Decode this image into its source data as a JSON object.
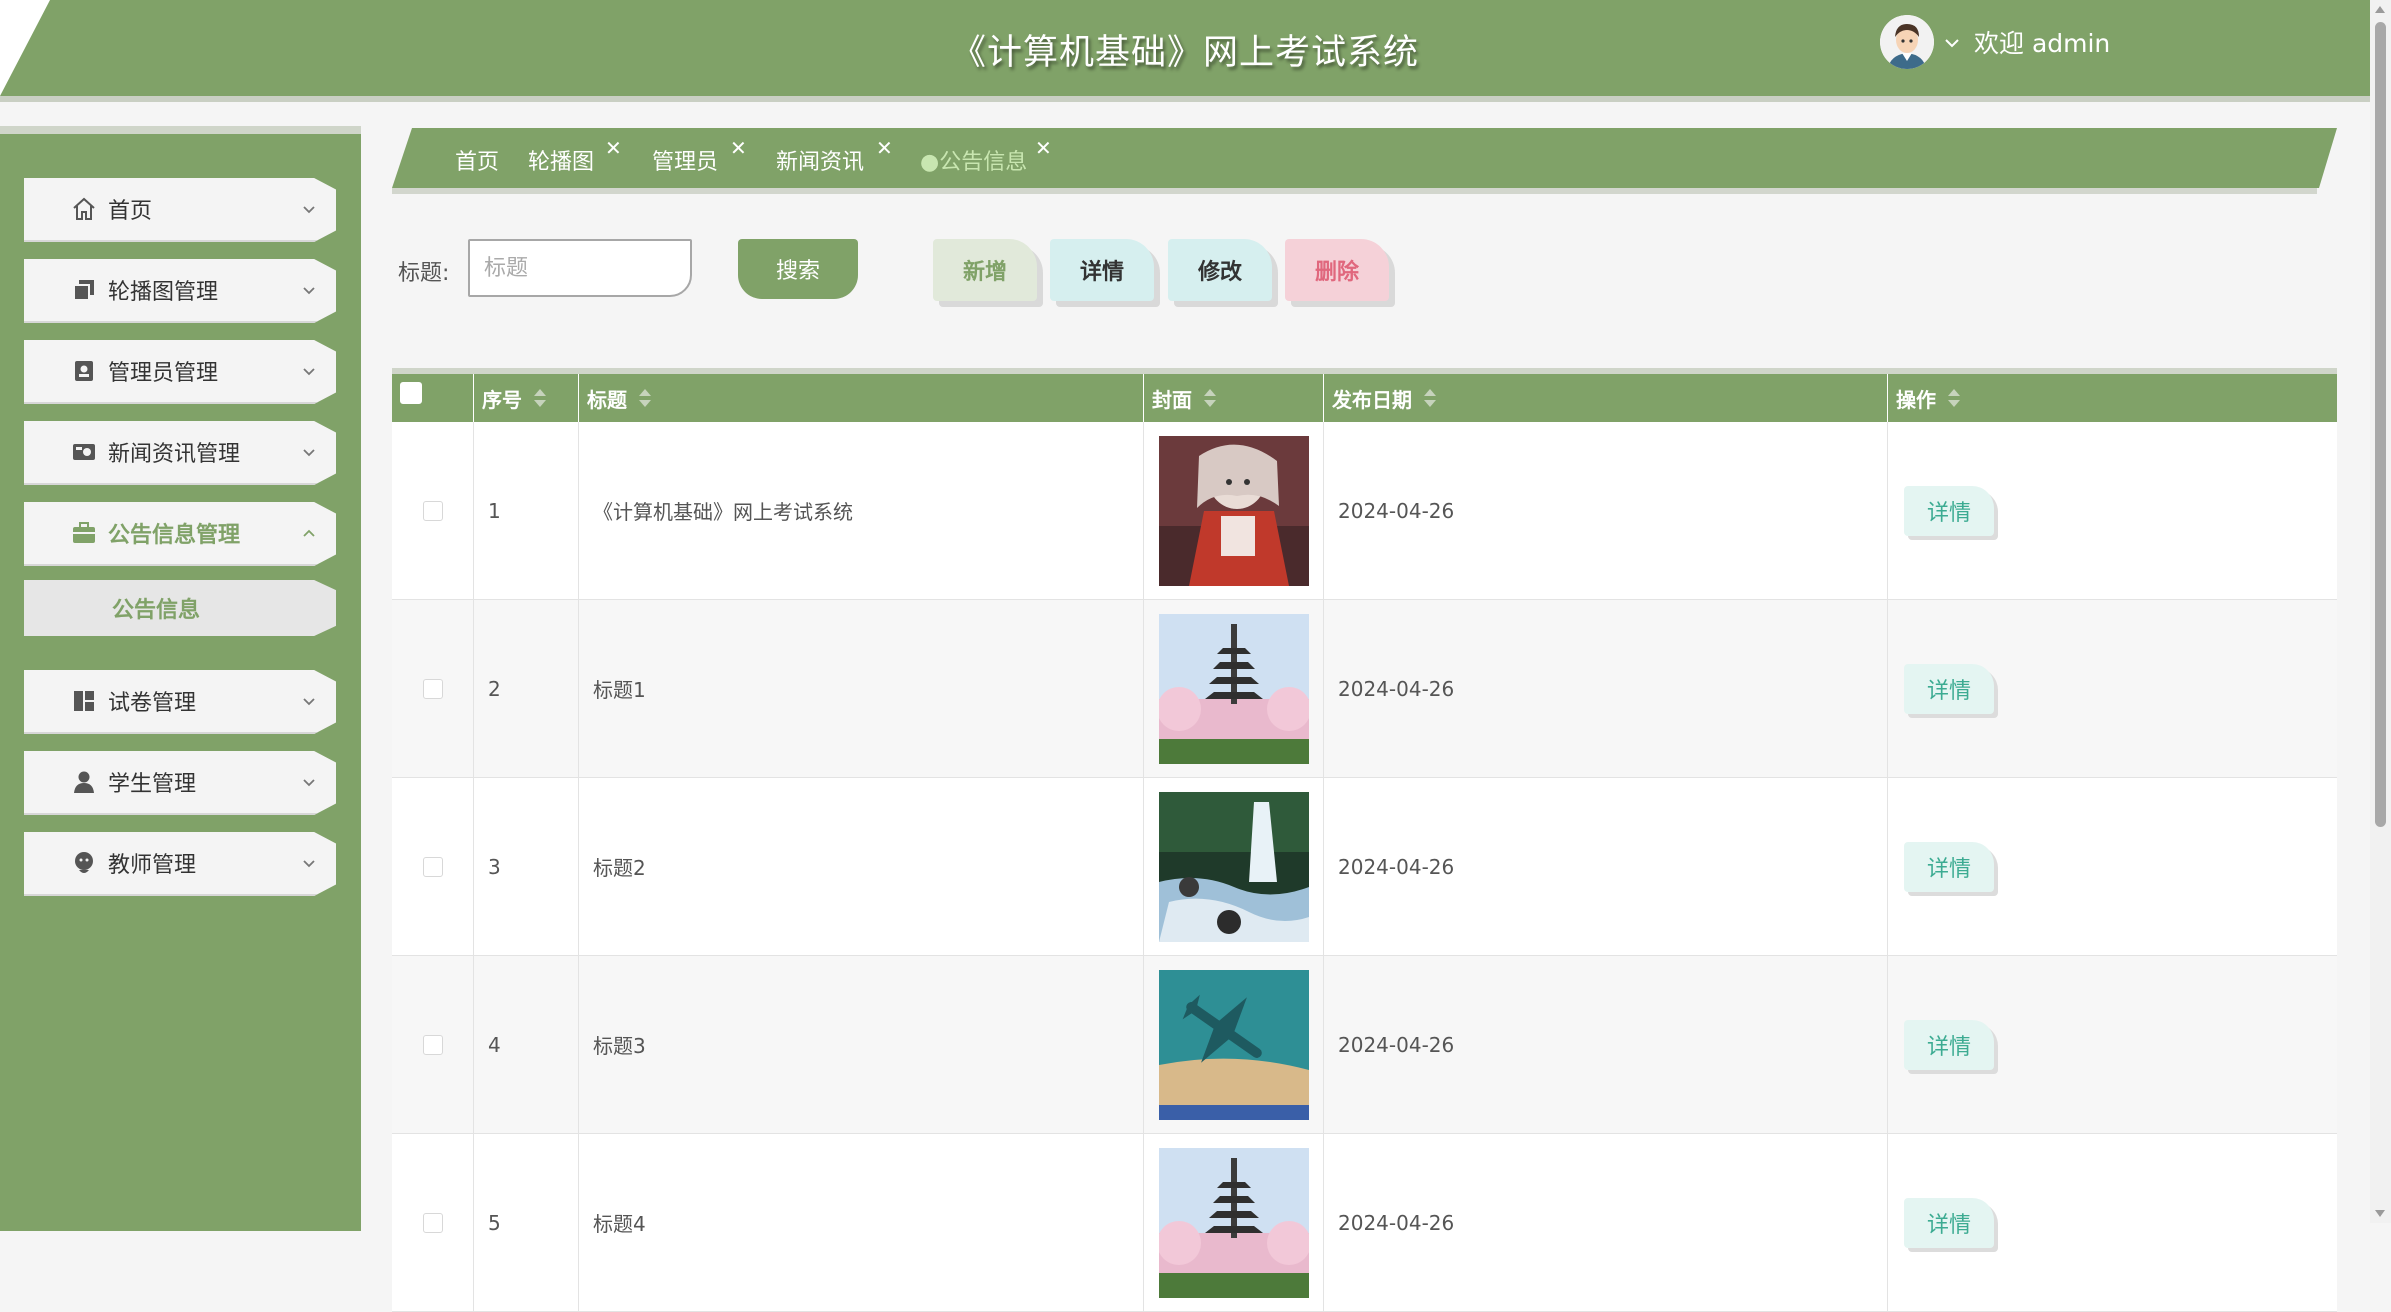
{
  "header": {
    "title": "《计算机基础》网上考试系统",
    "welcome": "欢迎 admin"
  },
  "sidebar": {
    "items": [
      {
        "label": "首页",
        "icon": "home-icon"
      },
      {
        "label": "轮播图管理",
        "icon": "carousel-icon"
      },
      {
        "label": "管理员管理",
        "icon": "admin-icon"
      },
      {
        "label": "新闻资讯管理",
        "icon": "news-icon"
      },
      {
        "label": "公告信息管理",
        "icon": "notice-icon"
      },
      {
        "label": "试卷管理",
        "icon": "paper-icon"
      },
      {
        "label": "学生管理",
        "icon": "student-icon"
      },
      {
        "label": "教师管理",
        "icon": "teacher-icon"
      }
    ],
    "sub_active": "公告信息"
  },
  "tabs": [
    {
      "label": "首页"
    },
    {
      "label": "轮播图"
    },
    {
      "label": "管理员"
    },
    {
      "label": "新闻资讯"
    },
    {
      "label": "●公告信息"
    }
  ],
  "search": {
    "label": "标题:",
    "placeholder": "标题",
    "button": "搜索"
  },
  "actions": {
    "add": "新增",
    "detail": "详情",
    "edit": "修改",
    "delete": "删除"
  },
  "table": {
    "columns": [
      "序号",
      "标题",
      "封面",
      "发布日期",
      "操作"
    ],
    "rows": [
      {
        "no": "1",
        "title": "《计算机基础》网上考试系统",
        "date": "2024-04-26",
        "op": "详情",
        "cover": "anime-girl-image"
      },
      {
        "no": "2",
        "title": "标题1",
        "date": "2024-04-26",
        "op": "详情",
        "cover": "pagoda-cherry-image"
      },
      {
        "no": "3",
        "title": "标题2",
        "date": "2024-04-26",
        "op": "详情",
        "cover": "waterfall-image"
      },
      {
        "no": "4",
        "title": "标题3",
        "date": "2024-04-26",
        "op": "详情",
        "cover": "airplane-beach-image"
      },
      {
        "no": "5",
        "title": "标题4",
        "date": "2024-04-26",
        "op": "详情",
        "cover": "pagoda-cherry-image"
      }
    ]
  },
  "colors": {
    "accent": "#80a268",
    "header_bg": "#80a268",
    "delete_text": "#e0677d"
  }
}
